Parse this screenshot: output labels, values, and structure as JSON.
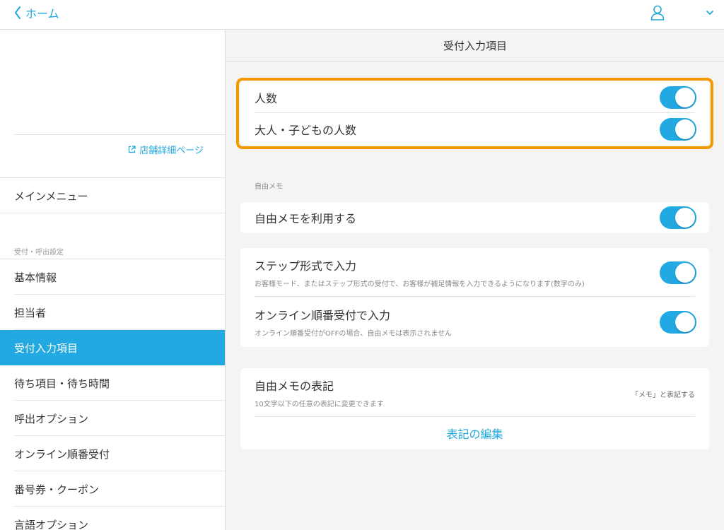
{
  "topbar": {
    "back_label": "ホーム",
    "icons": {
      "back": "chevron-left-icon",
      "user": "user-icon",
      "menu": "chevron-down-icon"
    }
  },
  "sidebar": {
    "shop_link": "店舗詳細ページ",
    "main_menu": "メインメニュー",
    "section_label": "受付・呼出設定",
    "items": [
      {
        "label": "基本情報",
        "active": false
      },
      {
        "label": "担当者",
        "active": false
      },
      {
        "label": "受付入力項目",
        "active": true
      },
      {
        "label": "待ち項目・待ち時間",
        "active": false
      },
      {
        "label": "呼出オプション",
        "active": false
      },
      {
        "label": "オンライン順番受付",
        "active": false
      },
      {
        "label": "番号券・クーポン",
        "active": false
      },
      {
        "label": "言語オプション",
        "active": false
      }
    ]
  },
  "main": {
    "title": "受付入力項目",
    "people": [
      {
        "label": "人数",
        "enabled": true
      },
      {
        "label": "大人・子どもの人数",
        "enabled": true
      }
    ],
    "memo_section_caption": "自由メモ",
    "use_memo": {
      "label": "自由メモを利用する",
      "enabled": true
    },
    "step_input": {
      "label": "ステップ形式で入力",
      "description": "お客様モード、またはステップ形式の受付で、お客様が補足情報を入力できるようになります(数字のみ)",
      "enabled": true
    },
    "online_input": {
      "label": "オンライン順番受付で入力",
      "description": "オンライン順番受付がOFFの場合、自由メモは表示されません",
      "enabled": true
    },
    "memo_notation": {
      "label": "自由メモの表記",
      "description": "10文字以下の任意の表記に変更できます",
      "current_value": "「メモ」と表記する",
      "edit_label": "表記の編集"
    }
  },
  "colors": {
    "accent": "#22a9e1",
    "highlight": "#f39a00",
    "link": "#1fa8e0"
  }
}
